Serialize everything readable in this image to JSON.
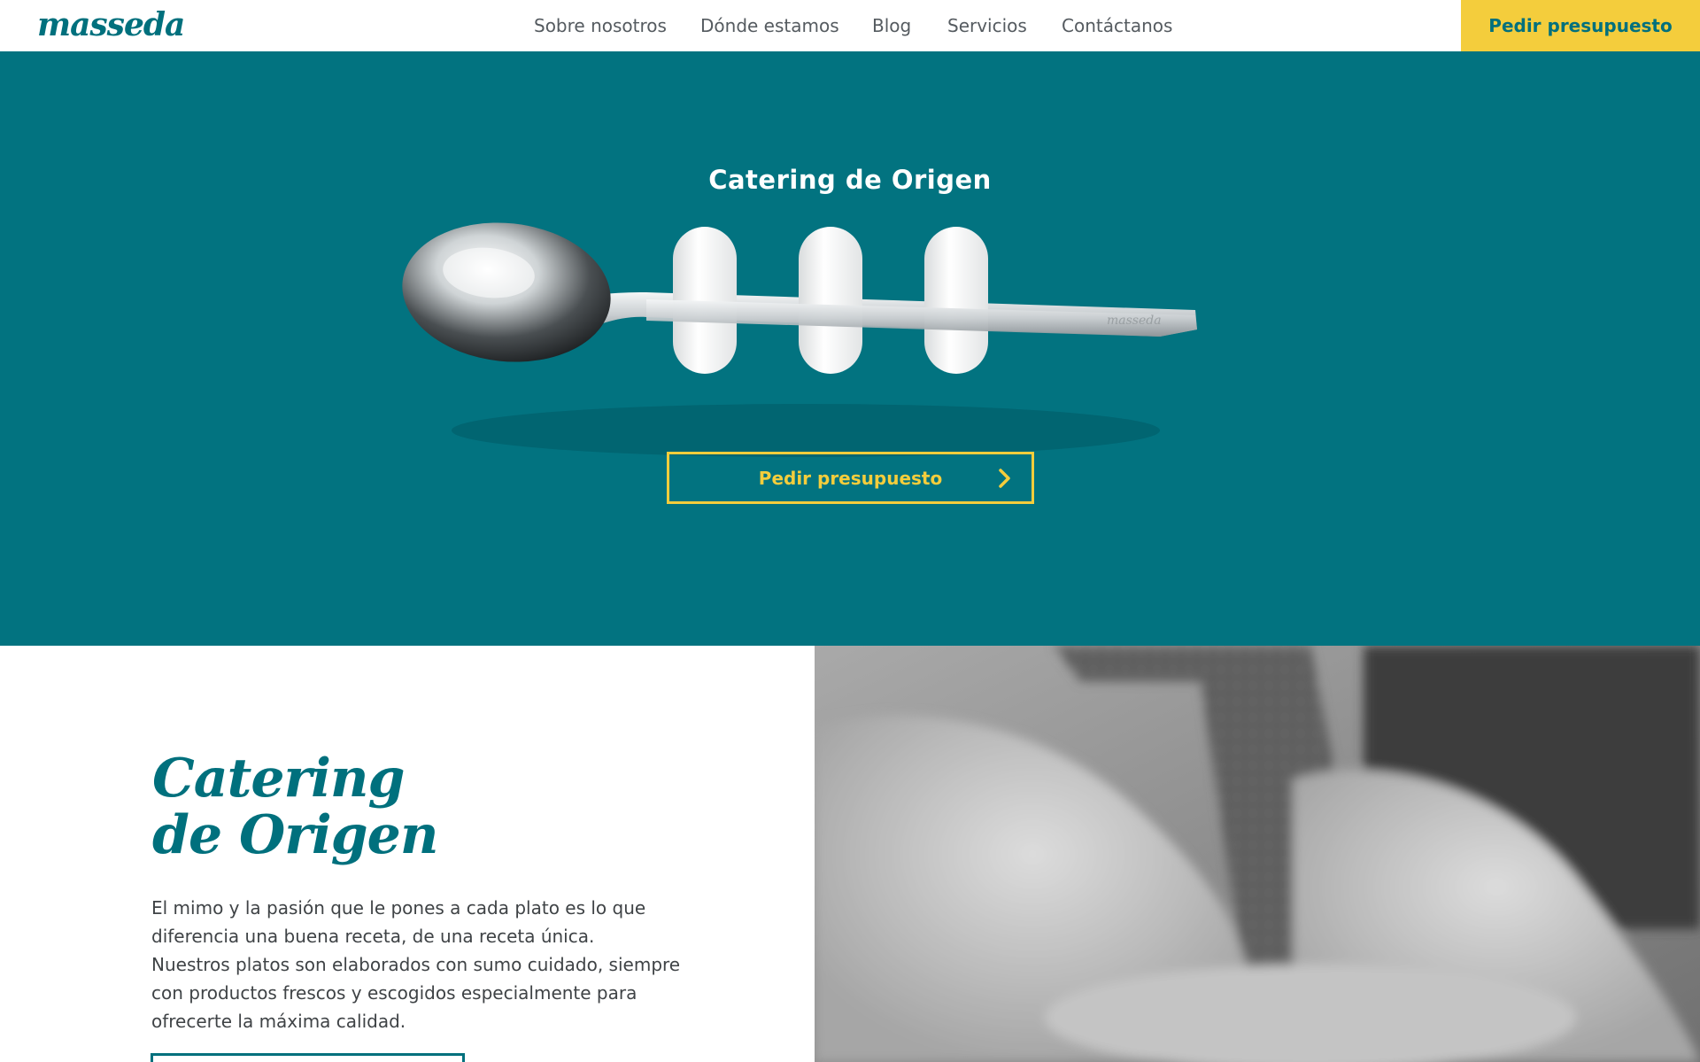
{
  "header": {
    "logo_text": "masseda",
    "nav": [
      "Sobre nosotros",
      "Dónde estamos",
      "Blog",
      "Servicios",
      "Contáctanos"
    ],
    "cta_label": "Pedir presupuesto"
  },
  "hero": {
    "title": "Catering de Origen",
    "button_label": "Pedir presupuesto",
    "spoon_engraving": "masseda"
  },
  "content": {
    "heading_line1": "Catering",
    "heading_line2": "de Origen",
    "text_lines": [
      "El mimo y la pasión que le pones a cada plato es lo que",
      "diferencia una buena receta, de una receta única.",
      "Nuestros platos son elaborados con sumo cuidado, siempre",
      "con productos frescos y escogidos especialmente para",
      "ofrecerte la máxima calidad."
    ]
  },
  "colors": {
    "brand_teal": "#00707d",
    "hero_background": "#027380",
    "accent_yellow": "#f4cd3c"
  },
  "icons": {
    "hero_button_icon": "chevron-right-icon"
  }
}
